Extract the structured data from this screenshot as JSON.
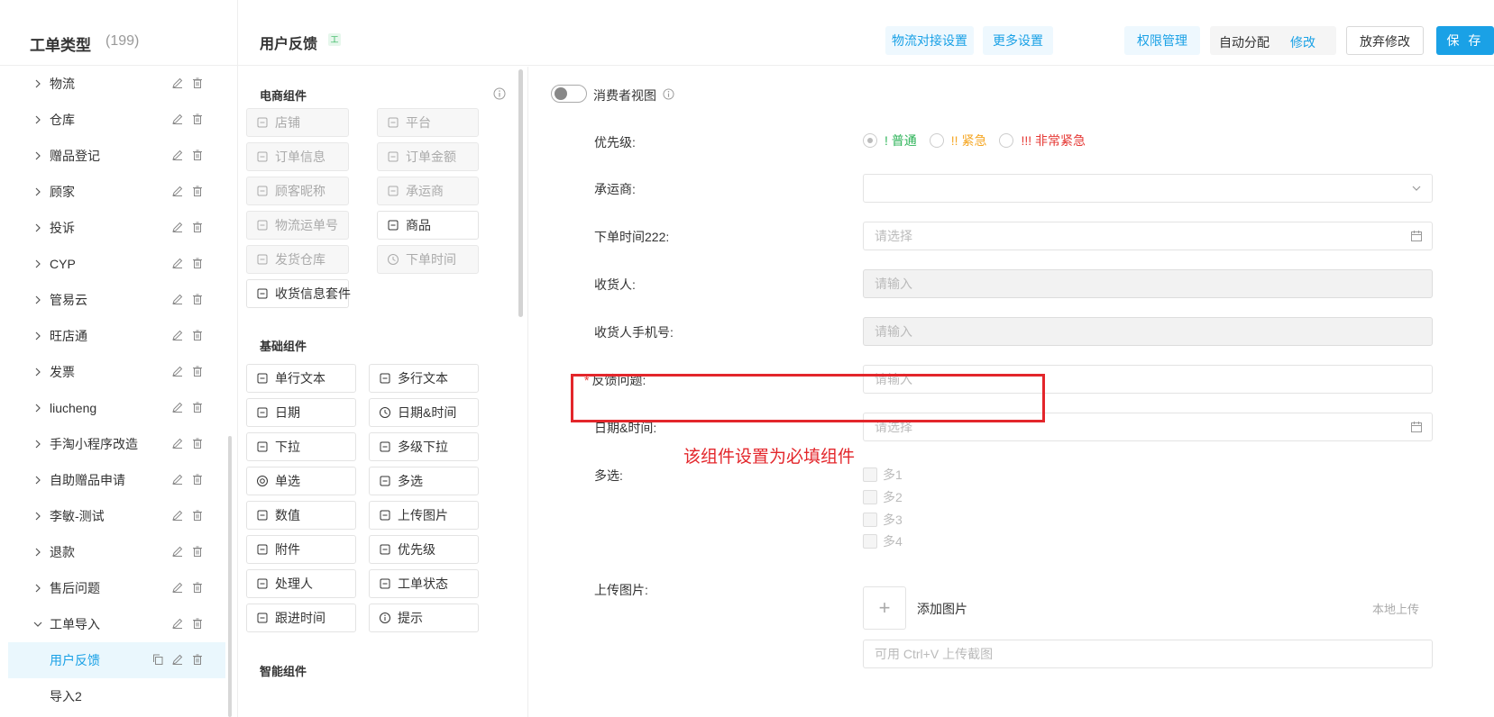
{
  "sidebar": {
    "title": "工单类型",
    "count": "(199)",
    "items": [
      {
        "label": "物流",
        "expanded": false
      },
      {
        "label": "仓库",
        "expanded": false
      },
      {
        "label": "赠品登记",
        "expanded": false
      },
      {
        "label": "顾家",
        "expanded": false
      },
      {
        "label": "投诉",
        "expanded": false
      },
      {
        "label": "CYP",
        "expanded": false
      },
      {
        "label": "管易云",
        "expanded": false
      },
      {
        "label": "旺店通",
        "expanded": false
      },
      {
        "label": "发票",
        "expanded": false
      },
      {
        "label": "liucheng",
        "expanded": false
      },
      {
        "label": "手淘小程序改造",
        "expanded": false
      },
      {
        "label": "自助赠品申请",
        "expanded": false
      },
      {
        "label": "李敏-测试",
        "expanded": false
      },
      {
        "label": "退款",
        "expanded": false
      },
      {
        "label": "售后问题",
        "expanded": false
      },
      {
        "label": "工单导入",
        "expanded": true
      }
    ],
    "children": [
      {
        "label": "用户反馈",
        "active": true
      },
      {
        "label": "导入2",
        "active": false
      }
    ]
  },
  "header": {
    "title": "用户反馈",
    "tag": "工",
    "buttons": {
      "logistics": "物流对接设置",
      "more": "更多设置",
      "permission": "权限管理",
      "auto_assign": "自动分配",
      "auto_assign_edit": "修改",
      "discard": "放弃修改",
      "save": "保 存"
    }
  },
  "palette": {
    "ecommerce": {
      "title": "电商组件",
      "items": [
        {
          "label": "店铺",
          "icon": "shop-icon",
          "disabled": true
        },
        {
          "label": "平台",
          "icon": "grid-icon",
          "disabled": true
        },
        {
          "label": "订单信息",
          "icon": "order-icon",
          "disabled": true
        },
        {
          "label": "订单金额",
          "icon": "amount-icon",
          "disabled": true
        },
        {
          "label": "顾客昵称",
          "icon": "user-icon",
          "disabled": true
        },
        {
          "label": "承运商",
          "icon": "truck-icon",
          "disabled": true
        },
        {
          "label": "物流运单号",
          "icon": "waybill-icon",
          "disabled": true
        },
        {
          "label": "商品",
          "icon": "bag-icon",
          "disabled": false
        },
        {
          "label": "发货仓库",
          "icon": "warehouse-icon",
          "disabled": true
        },
        {
          "label": "下单时间",
          "icon": "clock-icon",
          "disabled": true
        },
        {
          "label": "收货信息套件",
          "icon": "receipt-icon",
          "disabled": false
        }
      ]
    },
    "basic": {
      "title": "基础组件",
      "items": [
        {
          "label": "单行文本",
          "icon": "single-line-icon"
        },
        {
          "label": "多行文本",
          "icon": "multi-line-icon"
        },
        {
          "label": "日期",
          "icon": "calendar-icon"
        },
        {
          "label": "日期&时间",
          "icon": "clock-icon"
        },
        {
          "label": "下拉",
          "icon": "dropdown-icon"
        },
        {
          "label": "多级下拉",
          "icon": "cascade-icon"
        },
        {
          "label": "单选",
          "icon": "radio-icon"
        },
        {
          "label": "多选",
          "icon": "checkbox-icon"
        },
        {
          "label": "数值",
          "icon": "number-icon"
        },
        {
          "label": "上传图片",
          "icon": "image-icon"
        },
        {
          "label": "附件",
          "icon": "attachment-icon"
        },
        {
          "label": "优先级",
          "icon": "priority-icon"
        },
        {
          "label": "处理人",
          "icon": "handler-icon"
        },
        {
          "label": "工单状态",
          "icon": "status-icon"
        },
        {
          "label": "跟进时间",
          "icon": "followup-icon"
        },
        {
          "label": "提示",
          "icon": "info-icon"
        }
      ]
    },
    "smart": {
      "title": "智能组件"
    }
  },
  "form": {
    "consumer_view": "消费者视图",
    "priority": {
      "label": "优先级:",
      "options": [
        {
          "label": "! 普通",
          "color": "#2fb45a",
          "selected": true
        },
        {
          "label": "!! 紧急",
          "color": "#f5a623",
          "selected": false
        },
        {
          "label": "!!! 非常紧急",
          "color": "#e53935",
          "selected": false
        }
      ]
    },
    "carrier": {
      "label": "承运商:",
      "placeholder": ""
    },
    "order_time": {
      "label": "下单时间222:",
      "placeholder": "请选择"
    },
    "receiver": {
      "label": "收货人:",
      "placeholder": "请输入"
    },
    "receiver_phone": {
      "label": "收货人手机号:",
      "placeholder": "请输入"
    },
    "feedback": {
      "label": "反馈问题:",
      "placeholder": "请输入",
      "required": "*"
    },
    "datetime": {
      "label": "日期&时间:",
      "placeholder": "请选择"
    },
    "multi": {
      "label": "多选:",
      "options": [
        "多1",
        "多2",
        "多3",
        "多4"
      ]
    },
    "upload": {
      "label": "上传图片:",
      "add": "添加图片",
      "local": "本地上传",
      "paste_placeholder": "可用 Ctrl+V 上传截图"
    }
  },
  "annotation": {
    "text": "该组件设置为必填组件",
    "color": "#e3262b"
  },
  "colors": {
    "accent": "#1aa1e6",
    "annotation": "#e3262b"
  }
}
